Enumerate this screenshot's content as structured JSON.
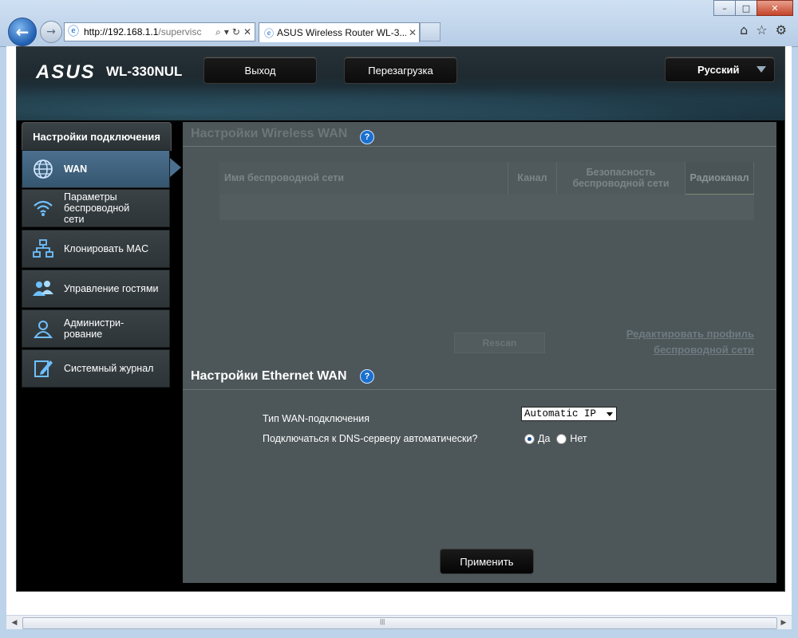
{
  "browser": {
    "address_host": "http://192.168.1.1",
    "address_rest": "/supervisc",
    "tab_title": "ASUS Wireless Router WL-3...",
    "icons": [
      "back-icon",
      "forward-icon",
      "search-icon",
      "refresh-icon",
      "stop-icon",
      "home-icon",
      "favorites-icon",
      "tools-icon"
    ]
  },
  "header": {
    "logo": "ASUS",
    "model": "WL-330NUL",
    "logout_label": "Выход",
    "reboot_label": "Перезагрузка",
    "language": "Русский"
  },
  "sidebar": {
    "title": "Настройки подключения",
    "items": [
      {
        "label": "WAN",
        "icon": "globe-icon",
        "active": true
      },
      {
        "label": "Параметры беспроводной сети",
        "icon": "wifi-icon",
        "active": false
      },
      {
        "label": "Клонировать MAC",
        "icon": "network-icon",
        "active": false
      },
      {
        "label": "Управление гостями",
        "icon": "guests-icon",
        "active": false
      },
      {
        "label": "Администри-рование",
        "icon": "admin-user-icon",
        "active": false
      },
      {
        "label": "Системный журнал",
        "icon": "log-edit-icon",
        "active": false
      }
    ]
  },
  "wireless_wan": {
    "title": "Настройки Wireless WAN",
    "columns": [
      "Имя беспроводной сети",
      "Канал",
      "Безопасность беспроводной сети",
      "Радиоканал"
    ],
    "rescan_label": "Rescan",
    "edit_profile_line1": "Редактировать профиль",
    "edit_profile_line2": "беспроводной сети"
  },
  "ethernet_wan": {
    "title": "Настройки Ethernet WAN",
    "wan_type_label": "Тип WAN-подключения",
    "wan_type_value": "Automatic IP",
    "dns_label": "Подключаться к DNS-серверу автоматически?",
    "dns_yes": "Да",
    "dns_no": "Нет",
    "dns_selected": "yes"
  },
  "apply_label": "Применить",
  "colors": {
    "panel": "#4d5659",
    "active_item": "#4b6f8e",
    "help_icon": "#1a6fd0"
  }
}
